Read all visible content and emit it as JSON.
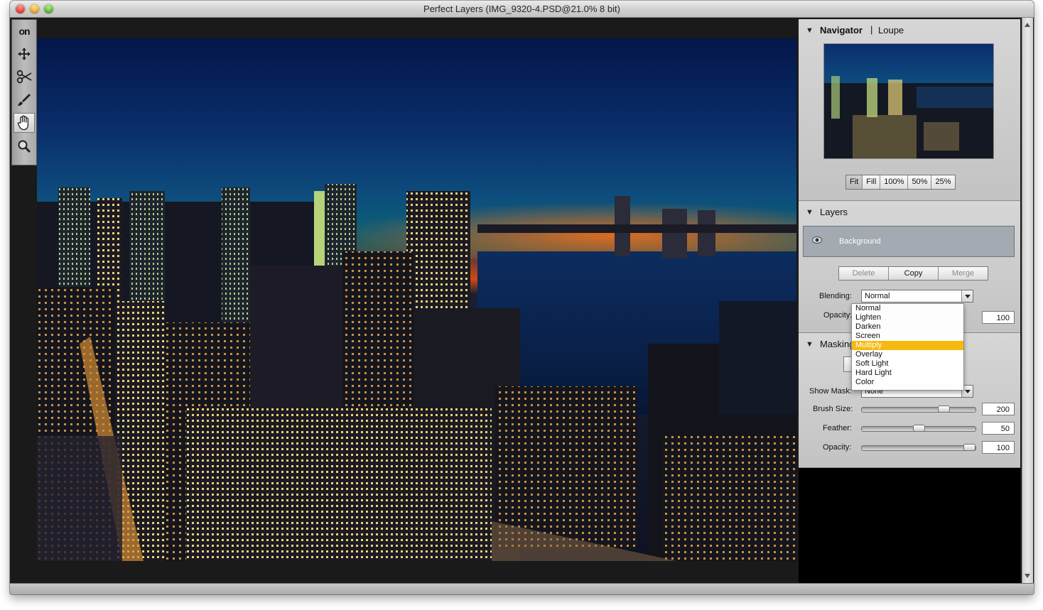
{
  "window": {
    "title": "Perfect Layers (IMG_9320-4.PSD@21.0% 8 bit)"
  },
  "toolbar": {
    "logo": "on",
    "tools": [
      "move-tool",
      "scissors-tool",
      "brush-tool",
      "hand-tool",
      "zoom-tool"
    ],
    "active_tool": "hand-tool"
  },
  "navigator": {
    "title": "Navigator",
    "tab_loupe": "Loupe",
    "zoom_buttons": [
      "Fit",
      "Fill",
      "100%",
      "50%",
      "25%"
    ],
    "selected_zoom": "Fit"
  },
  "layers": {
    "title": "Layers",
    "layer_name": "Background",
    "delete_label": "Delete",
    "copy_label": "Copy",
    "merge_label": "Merge",
    "blending_label": "Blending:",
    "blending_value": "Normal",
    "opacity_label": "Opacity:",
    "opacity_value": "100"
  },
  "blend_menu": {
    "options": [
      "Normal",
      "Lighten",
      "Darken",
      "Screen",
      "Multiply",
      "Overlay",
      "Soft Light",
      "Hard Light",
      "Color"
    ],
    "highlighted": "Multiply"
  },
  "masking": {
    "title": "Masking",
    "show_mask_label": "Show Mask:",
    "show_mask_value": "None",
    "brush_size_label": "Brush Size:",
    "brush_size_value": "200",
    "brush_size_level": 0.75,
    "feather_label": "Feather:",
    "feather_value": "50",
    "feather_level": 0.5,
    "opacity_label": "Opacity:",
    "opacity_value": "100",
    "opacity_level": 1.0
  },
  "colors": {
    "highlight": "#f6b90f",
    "panel": "#c9c9c9",
    "layer_row": "#a4aab1"
  }
}
